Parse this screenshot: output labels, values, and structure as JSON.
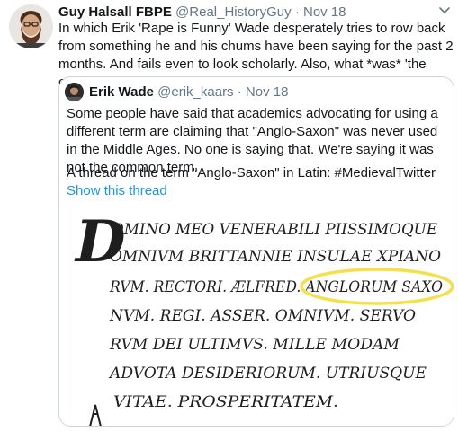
{
  "tweet": {
    "author_name": "Guy Halsall FBPE",
    "author_handle": "@Real_HistoryGuy",
    "separator": "·",
    "date": "Nov 18",
    "text": "In which Erik 'Rape is Funny' Wade desperately tries to row back from something he and his chums have been saying for the past 2 months. And fails even to look scholarly. Also, what *was* 'the common term'?",
    "menu_icon": "chevron-down-icon"
  },
  "quote": {
    "author_name": "Erik Wade",
    "author_handle": "@erik_kaars",
    "separator": "·",
    "date": "Nov 18",
    "text": "Some people have said that academics advocating for using a different term are claiming that \"Anglo-Saxon\" was never used in the Middle Ages. No one is saying that. We're saying it was not the common term.",
    "thread_text": "A thread on the term \"Anglo-Saxon\" in Latin: #MedievalTwitter",
    "show_thread": "Show this thread"
  },
  "manuscript": {
    "initial": "D",
    "lines": [
      "OMINO MEO VENERABILI PIISSIMOQUE",
      "OMNIVM BRITTANNIE INSULAE XPIANO",
      "RVM. RECTORI. ÆLFRED. ANGLORUM SAXO",
      "NVM. REGI. ASSER. OMNIVM. SERVO",
      "RVM DEI ULTIMVS. MILLE MODAM",
      "ADVOTA DESIDERIORUM. UTRIUSQUE",
      "VITAE. PROSPERITATEM."
    ],
    "highlight_color": "#f4e04d"
  }
}
